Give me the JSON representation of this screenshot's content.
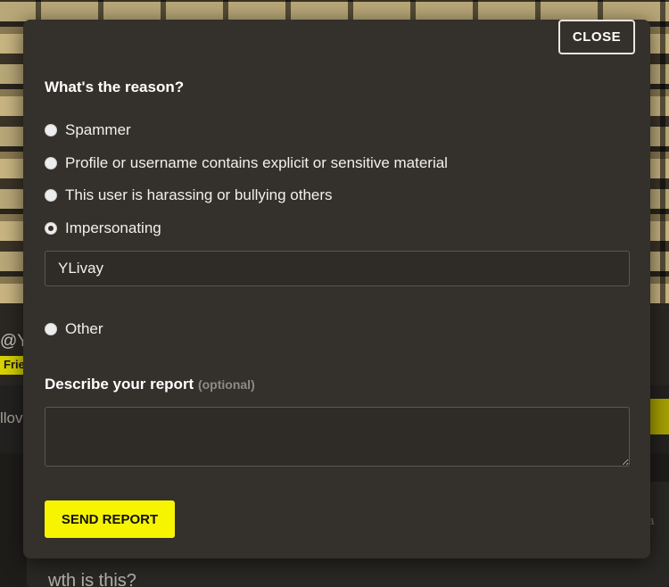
{
  "background": {
    "handle_fragment": "@Y",
    "badge_fragment": "Frie",
    "tab_fragment": "llov",
    "post_meta_fragment": "o da",
    "post_text": "wth is this?"
  },
  "modal": {
    "close_label": "CLOSE",
    "question": "What's the reason?",
    "options": [
      {
        "label": "Spammer",
        "checked": false
      },
      {
        "label": "Profile or username contains explicit or sensitive material",
        "checked": false
      },
      {
        "label": "This user is harassing or bullying others",
        "checked": false
      },
      {
        "label": "Impersonating",
        "checked": true
      },
      {
        "label": "Other",
        "checked": false
      }
    ],
    "impersonating_input_value": "YLivay",
    "describe_title": "Describe your report",
    "describe_optional": "(optional)",
    "describe_value": "",
    "send_label": "SEND REPORT"
  },
  "colors": {
    "accent": "#f7f400",
    "modal_bg": "#34302b"
  }
}
